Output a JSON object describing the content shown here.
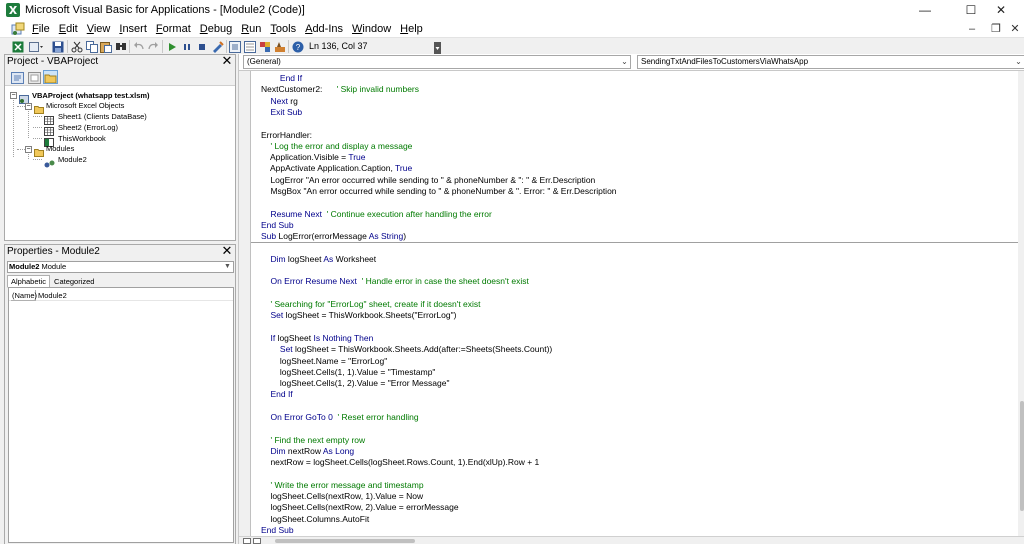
{
  "window": {
    "title": "Microsoft Visual Basic for Applications - [Module2 (Code)]",
    "minimize_glyph": "—",
    "maximize_glyph": "☐",
    "close_glyph": "✕",
    "mdi_minimize_glyph": "–",
    "mdi_restore_glyph": "❐",
    "mdi_close_glyph": "✕"
  },
  "menu": {
    "items": [
      {
        "u": "F",
        "rest": "ile"
      },
      {
        "u": "E",
        "rest": "dit"
      },
      {
        "u": "V",
        "rest": "iew"
      },
      {
        "u": "I",
        "rest": "nsert"
      },
      {
        "u": "F",
        "rest": "ormat"
      },
      {
        "u": "D",
        "rest": "ebug"
      },
      {
        "u": "R",
        "rest": "un"
      },
      {
        "u": "T",
        "rest": "ools"
      },
      {
        "u": "A",
        "rest": "dd-Ins"
      },
      {
        "u": "W",
        "rest": "indow"
      },
      {
        "u": "H",
        "rest": "elp"
      }
    ]
  },
  "toolbar": {
    "position": "Ln 136, Col 37"
  },
  "project_pane": {
    "title": "Project - VBAProject",
    "close_glyph": "✕",
    "tree": {
      "root": "VBAProject (whatsapp test.xlsm)",
      "excel_objects_folder": "Microsoft Excel Objects",
      "sheet1": "Sheet1 (Clients DataBase)",
      "sheet2": "Sheet2 (ErrorLog)",
      "workbook": "ThisWorkbook",
      "modules_folder": "Modules",
      "module2": "Module2"
    }
  },
  "properties_pane": {
    "title": "Properties - Module2",
    "close_glyph": "✕",
    "object_name": "Module2",
    "object_type": "Module",
    "tabs": [
      "Alphabetic",
      "Categorized"
    ],
    "rows": [
      {
        "name": "(Name)",
        "value": "Module2"
      }
    ]
  },
  "code_window": {
    "object_combo": "(General)",
    "procedure_combo": "SendingTxtAndFilesToCustomersViaWhatsApp",
    "lines": [
      [
        {
          "t": "        "
        },
        {
          "t": "End If",
          "c": "kw"
        }
      ],
      [
        {
          "t": "NextCustomer2:      "
        },
        {
          "t": "' Skip invalid numbers",
          "c": "cm"
        }
      ],
      [
        {
          "t": "    "
        },
        {
          "t": "Next",
          "c": "kw"
        },
        {
          "t": " rg"
        }
      ],
      [
        {
          "t": "    "
        },
        {
          "t": "Exit Sub",
          "c": "kw"
        }
      ],
      [
        {
          "t": ""
        }
      ],
      [
        {
          "t": "ErrorHandler:"
        }
      ],
      [
        {
          "t": "    "
        },
        {
          "t": "' Log the error and display a message",
          "c": "cm"
        }
      ],
      [
        {
          "t": "    Application.Visible = "
        },
        {
          "t": "True",
          "c": "kw"
        }
      ],
      [
        {
          "t": "    AppActivate Application.Caption, "
        },
        {
          "t": "True",
          "c": "kw"
        }
      ],
      [
        {
          "t": "    LogError \"An error occurred while sending to \" & phoneNumber & \": \" & Err.Description"
        }
      ],
      [
        {
          "t": "    MsgBox \"An error occurred while sending to \" & phoneNumber & \". Error: \" & Err.Description"
        }
      ],
      [
        {
          "t": ""
        }
      ],
      [
        {
          "t": "    "
        },
        {
          "t": "Resume Next",
          "c": "kw"
        },
        {
          "t": "  "
        },
        {
          "t": "' Continue execution after handling the error",
          "c": "cm"
        }
      ],
      [
        {
          "t": "End Sub",
          "c": "kw"
        }
      ],
      [
        {
          "t": "Sub",
          "c": "kw"
        },
        {
          "t": " LogError(errorMessage "
        },
        {
          "t": "As String",
          "c": "kw"
        },
        {
          "t": ")"
        }
      ],
      [
        {
          "t": ""
        }
      ],
      [
        {
          "t": "    "
        },
        {
          "t": "Dim",
          "c": "kw"
        },
        {
          "t": " logSheet "
        },
        {
          "t": "As",
          "c": "kw"
        },
        {
          "t": " Worksheet"
        }
      ],
      [
        {
          "t": ""
        }
      ],
      [
        {
          "t": "    "
        },
        {
          "t": "On Error Resume Next",
          "c": "kw"
        },
        {
          "t": "  "
        },
        {
          "t": "' Handle error in case the sheet doesn't exist",
          "c": "cm"
        }
      ],
      [
        {
          "t": ""
        }
      ],
      [
        {
          "t": "    "
        },
        {
          "t": "' Searching for \"ErrorLog\" sheet, create if it doesn't exist",
          "c": "cm"
        }
      ],
      [
        {
          "t": "    "
        },
        {
          "t": "Set",
          "c": "kw"
        },
        {
          "t": " logSheet = ThisWorkbook.Sheets(\"ErrorLog\")"
        }
      ],
      [
        {
          "t": ""
        }
      ],
      [
        {
          "t": "    "
        },
        {
          "t": "If",
          "c": "kw"
        },
        {
          "t": " logSheet "
        },
        {
          "t": "Is Nothing Then",
          "c": "kw"
        }
      ],
      [
        {
          "t": "        "
        },
        {
          "t": "Set",
          "c": "kw"
        },
        {
          "t": " logSheet = ThisWorkbook.Sheets.Add(after:=Sheets(Sheets.Count))"
        }
      ],
      [
        {
          "t": "        logSheet.Name = \"ErrorLog\""
        }
      ],
      [
        {
          "t": "        logSheet.Cells(1, 1).Value = \"Timestamp\""
        }
      ],
      [
        {
          "t": "        logSheet.Cells(1, 2).Value = \"Error Message\""
        }
      ],
      [
        {
          "t": "    "
        },
        {
          "t": "End If",
          "c": "kw"
        }
      ],
      [
        {
          "t": ""
        }
      ],
      [
        {
          "t": "    "
        },
        {
          "t": "On Error GoTo 0",
          "c": "kw"
        },
        {
          "t": "  "
        },
        {
          "t": "' Reset error handling",
          "c": "cm"
        }
      ],
      [
        {
          "t": ""
        }
      ],
      [
        {
          "t": "    "
        },
        {
          "t": "' Find the next empty row",
          "c": "cm"
        }
      ],
      [
        {
          "t": "    "
        },
        {
          "t": "Dim",
          "c": "kw"
        },
        {
          "t": " nextRow "
        },
        {
          "t": "As Long",
          "c": "kw"
        }
      ],
      [
        {
          "t": "    nextRow = logSheet.Cells(logSheet.Rows.Count, 1).End(xlUp).Row + 1"
        }
      ],
      [
        {
          "t": ""
        }
      ],
      [
        {
          "t": "    "
        },
        {
          "t": "' Write the error message and timestamp",
          "c": "cm"
        }
      ],
      [
        {
          "t": "    logSheet.Cells(nextRow, 1).Value = Now"
        }
      ],
      [
        {
          "t": "    logSheet.Cells(nextRow, 2).Value = errorMessage"
        }
      ],
      [
        {
          "t": "    logSheet.Columns.AutoFit"
        }
      ],
      [
        {
          "t": "End Sub",
          "c": "kw"
        }
      ]
    ]
  },
  "colors": {
    "keyword": "#00008b",
    "comment": "#007a00",
    "text": "#000000"
  }
}
